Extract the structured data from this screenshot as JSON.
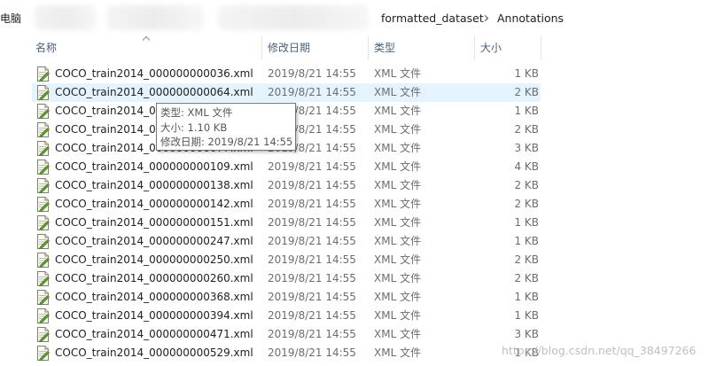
{
  "addressbar": {
    "root_fragment": "电脑",
    "crumbs": [
      "formatted_dataset",
      "Annotations"
    ]
  },
  "columns": {
    "name": "名称",
    "date": "修改日期",
    "type": "类型",
    "size": "大小"
  },
  "files": [
    {
      "name": "COCO_train2014_000000000036.xml",
      "date": "2019/8/21 14:55",
      "type": "XML 文件",
      "size": "1 KB"
    },
    {
      "name": "COCO_train2014_000000000064.xml",
      "date": "2019/8/21 14:55",
      "type": "XML 文件",
      "size": "2 KB"
    },
    {
      "name": "COCO_train2014_000000000071.xml",
      "date": "2019/8/21 14:55",
      "type": "XML 文件",
      "size": "1 KB"
    },
    {
      "name": "COCO_train2014_000000000072.xml",
      "date": "2019/8/21 14:55",
      "type": "XML 文件",
      "size": "2 KB"
    },
    {
      "name": "COCO_train2014_000000000077.xml",
      "date": "2019/8/21 14:55",
      "type": "XML 文件",
      "size": "3 KB"
    },
    {
      "name": "COCO_train2014_000000000109.xml",
      "date": "2019/8/21 14:55",
      "type": "XML 文件",
      "size": "4 KB"
    },
    {
      "name": "COCO_train2014_000000000138.xml",
      "date": "2019/8/21 14:55",
      "type": "XML 文件",
      "size": "2 KB"
    },
    {
      "name": "COCO_train2014_000000000142.xml",
      "date": "2019/8/21 14:55",
      "type": "XML 文件",
      "size": "2 KB"
    },
    {
      "name": "COCO_train2014_000000000151.xml",
      "date": "2019/8/21 14:55",
      "type": "XML 文件",
      "size": "1 KB"
    },
    {
      "name": "COCO_train2014_000000000247.xml",
      "date": "2019/8/21 14:55",
      "type": "XML 文件",
      "size": "1 KB"
    },
    {
      "name": "COCO_train2014_000000000250.xml",
      "date": "2019/8/21 14:55",
      "type": "XML 文件",
      "size": "2 KB"
    },
    {
      "name": "COCO_train2014_000000000260.xml",
      "date": "2019/8/21 14:55",
      "type": "XML 文件",
      "size": "2 KB"
    },
    {
      "name": "COCO_train2014_000000000368.xml",
      "date": "2019/8/21 14:55",
      "type": "XML 文件",
      "size": "1 KB"
    },
    {
      "name": "COCO_train2014_000000000394.xml",
      "date": "2019/8/21 14:55",
      "type": "XML 文件",
      "size": "1 KB"
    },
    {
      "name": "COCO_train2014_000000000471.xml",
      "date": "2019/8/21 14:55",
      "type": "XML 文件",
      "size": "3 KB"
    },
    {
      "name": "COCO_train2014_000000000529.xml",
      "date": "2019/8/21 14:55",
      "type": "XML 文件",
      "size": "1 KB"
    }
  ],
  "hover_row": 1,
  "tooltip": {
    "type_line": "类型: XML 文件",
    "size_line": "大小: 1.10 KB",
    "date_line": "修改日期: 2019/8/21 14:55"
  },
  "watermark": "https://blog.csdn.net/qq_38497266",
  "icon": "xml-file-icon",
  "colors": {
    "header_text": "#4c607a",
    "hover_row": "#e5f3ff",
    "secondary_text": "#6d6d6d"
  }
}
